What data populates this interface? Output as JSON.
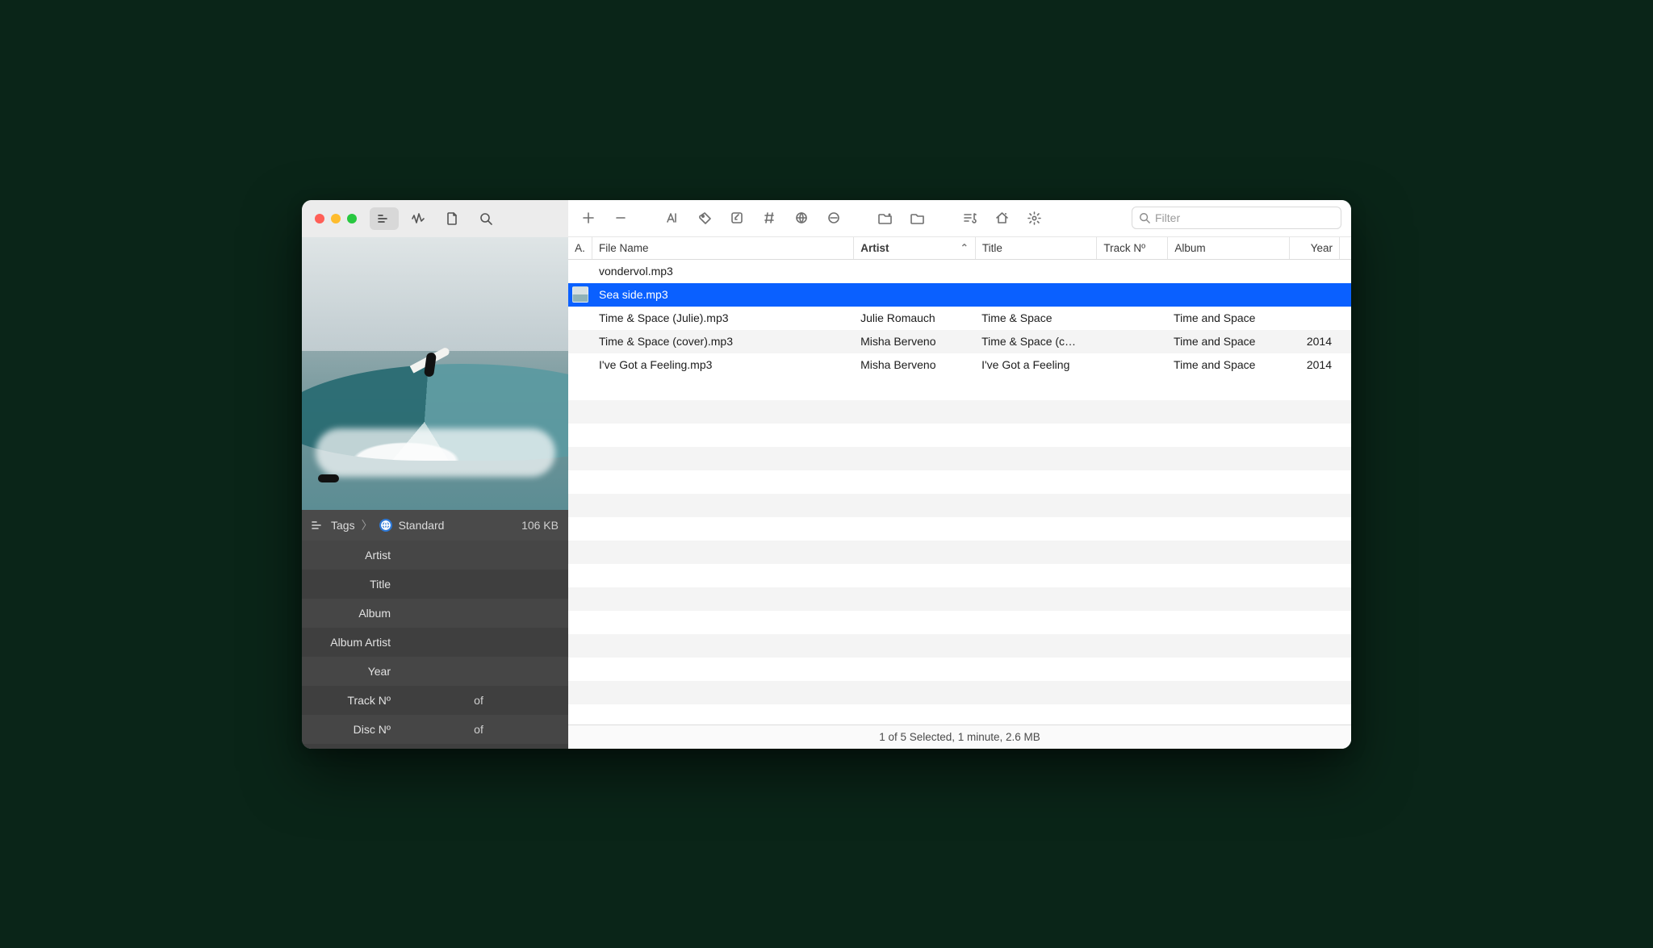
{
  "filter": {
    "placeholder": "Filter",
    "value": ""
  },
  "columns": {
    "a": "A.",
    "file": "File Name",
    "artist": "Artist",
    "title": "Title",
    "track": "Track Nº",
    "album": "Album",
    "year": "Year"
  },
  "sort": {
    "column": "artist",
    "direction": "asc"
  },
  "rows": [
    {
      "file": "vondervol.mp3",
      "artist": "",
      "title": "",
      "track": "",
      "album": "",
      "year": "",
      "selected": false,
      "thumb": false
    },
    {
      "file": "Sea side.mp3",
      "artist": "",
      "title": "",
      "track": "",
      "album": "",
      "year": "",
      "selected": true,
      "thumb": true
    },
    {
      "file": "Time & Space (Julie).mp3",
      "artist": "Julie Romauch",
      "title": "Time & Space",
      "track": "",
      "album": "Time and Space",
      "year": "",
      "selected": false,
      "thumb": false
    },
    {
      "file": "Time & Space (cover).mp3",
      "artist": "Misha Berveno",
      "title": "Time & Space (c…",
      "track": "",
      "album": "Time and Space",
      "year": "2014",
      "selected": false,
      "thumb": false
    },
    {
      "file": "I've Got a Feeling.mp3",
      "artist": "Misha Berveno",
      "title": "I've Got a Feeling",
      "track": "",
      "album": "Time and Space",
      "year": "2014",
      "selected": false,
      "thumb": false
    }
  ],
  "status": "1 of 5 Selected, 1 minute, 2.6 MB",
  "sidebar": {
    "breadcrumb": {
      "root": "Tags",
      "leaf": "Standard"
    },
    "file_size": "106 KB",
    "fields": {
      "artist_label": "Artist",
      "title_label": "Title",
      "album_label": "Album",
      "album_artist_label": "Album Artist",
      "year_label": "Year",
      "track_label": "Track Nº",
      "disc_label": "Disc Nº",
      "of_label": "of",
      "artist": "",
      "title": "",
      "album": "",
      "album_artist": "",
      "year": "",
      "track": "",
      "track_total": "",
      "disc": "",
      "disc_total": ""
    }
  }
}
